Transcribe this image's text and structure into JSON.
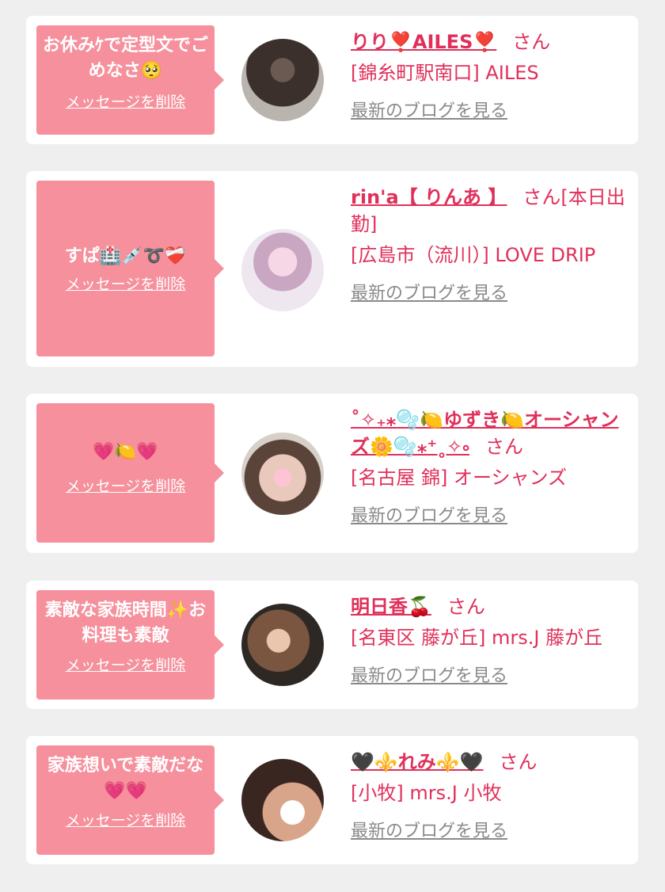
{
  "colors": {
    "accent": "#e0305a",
    "bubble": "#f5909c",
    "card": "#ffffff",
    "background": "#efefef",
    "muted": "#8a8a8a"
  },
  "delete_label": "メッセージを削除",
  "blog_label": "最新のブログを見る",
  "honorific": "さん",
  "cards": [
    {
      "message": "お休みｹで定型文でごめなさ🥺",
      "name": "りり❣️AILES❣️",
      "honorific_suffix": "",
      "shop": "[錦糸町駅南口] AILES",
      "avatar": "woman-long-hair-photo"
    },
    {
      "message": "すぱ🏥💉➰❤️‍🩹",
      "name": "rin'a【 りんあ 】",
      "honorific_suffix": "[本日出勤]",
      "shop": "[広島市（流川）] LOVE DRIP",
      "avatar": "nurse-costume-photo"
    },
    {
      "message": "💗🍋💗",
      "name": "˚✧₊⁎🫧🍋ゆずき🍋オーシャンズ🌼🫧⁎⁺˳✧༚",
      "honorific_suffix": "",
      "shop": "[名古屋 錦] オーシャンズ",
      "avatar": "face-hidden-photo"
    },
    {
      "message": "素敵な家族時間✨お料理も素敵",
      "name": "明日香🍒",
      "honorific_suffix": "",
      "shop": "[名東区 藤が丘] mrs.J 藤が丘",
      "avatar": "woman-profile-photo"
    },
    {
      "message": "家族想いで素敵だな💗💗",
      "name": "🖤⚜️れみ⚜️🖤",
      "honorific_suffix": "",
      "shop": "[小牧] mrs.J 小牧",
      "avatar": "face-heart-covered-photo"
    }
  ]
}
